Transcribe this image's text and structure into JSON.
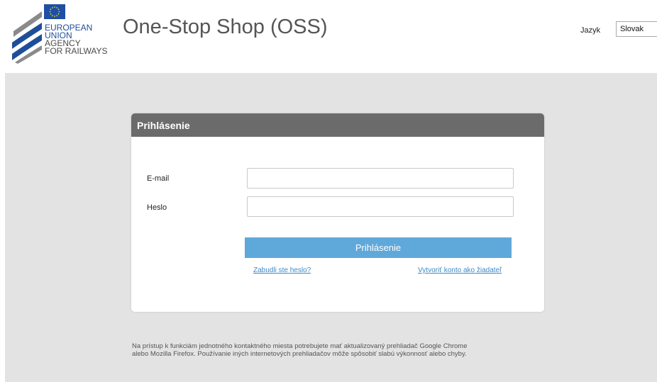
{
  "header": {
    "logo": {
      "line1": "EUROPEAN",
      "line2": "UNION",
      "line3": "AGENCY",
      "line4": "FOR RAILWAYS",
      "flag_icon": "eu-flag-icon"
    },
    "title": "One-Stop Shop (OSS)",
    "language_label": "Jazyk",
    "language_value": "Slovak"
  },
  "login": {
    "heading": "Prihlásenie",
    "email_label": "E-mail",
    "email_value": "",
    "password_label": "Heslo",
    "password_value": "",
    "submit_label": "Prihlásenie",
    "forgot_link": "Zabudli ste heslo?",
    "register_link": "Vytvoriť konto ako žiadateľ"
  },
  "notice": {
    "line1": "Na prístup k funkciám jednotného kontaktného miesta potrebujete mať aktualizovaný prehliadač Google Chrome",
    "line2": "alebo Mozilla Firefox. Používanie iných internetových prehliadačov môže spôsobiť slabú výkonnosť alebo chyby."
  },
  "colors": {
    "card_header": "#6b6b6b",
    "button": "#5fa8da",
    "link": "#3e8ac7",
    "background": "#e3e3e3",
    "logo_blue": "#1f4e99"
  }
}
